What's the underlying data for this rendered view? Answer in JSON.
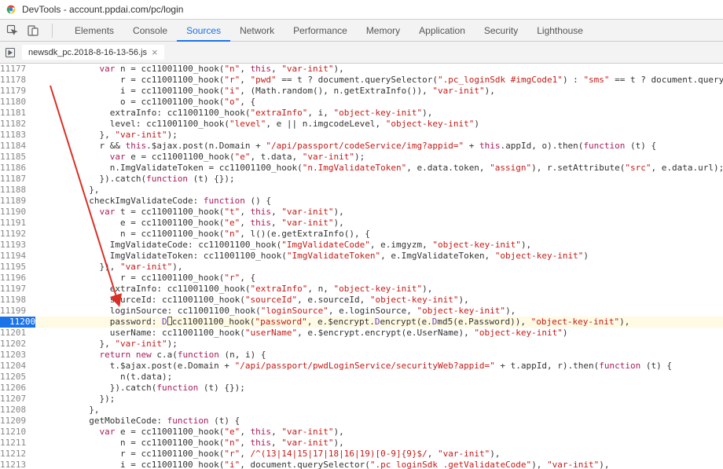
{
  "window": {
    "title": "DevTools - account.ppdai.com/pc/login"
  },
  "panels": {
    "elements": "Elements",
    "console": "Console",
    "sources": "Sources",
    "network": "Network",
    "performance": "Performance",
    "memory": "Memory",
    "application": "Application",
    "security": "Security",
    "lighthouse": "Lighthouse"
  },
  "active_panel": "sources",
  "file": {
    "name": "newsdk_pc.2018-8-16-13-56.js",
    "close": "×"
  },
  "gutter_start": 11177,
  "highlighted_line": 11200,
  "code_lines": [
    "            <kw>var</kw> n = cc11001100_hook(<str>\"n\"</str>, <kw>this</kw>, <str>\"var-init\"</str>),",
    "                r = cc11001100_hook(<str>\"r\"</str>, <str>\"pwd\"</str> == t ? document.querySelector(<str>\".pc_loginSdk #imgCode1\"</str>) : <str>\"sms\"</str> == t ? document.querySele",
    "                i = cc11001100_hook(<str>\"i\"</str>, (Math.random(), n.getExtraInfo()), <str>\"var-init\"</str>),",
    "                o = cc11001100_hook(<str>\"o\"</str>, {",
    "              extraInfo: cc11001100_hook(<str>\"extraInfo\"</str>, i, <str>\"object-key-init\"</str>),",
    "              level: cc11001100_hook(<str>\"level\"</str>, e || n.imgcodeLevel, <str>\"object-key-init\"</str>)",
    "            }, <str>\"var-init\"</str>);",
    "            r && <kw>this</kw>.$ajax.post(n.Domain + <str>\"/api/passport/codeService/img?appid=\"</str> + <kw>this</kw>.appId, o).then(<kw>function</kw> (t) {",
    "              <kw>var</kw> e = cc11001100_hook(<str>\"e\"</str>, t.data, <str>\"var-init\"</str>);",
    "              n.ImgValidateToken = cc11001100_hook(<str>\"n.ImgValidateToken\"</str>, e.data.token, <str>\"assign\"</str>), r.setAttribute(<str>\"src\"</str>, e.data.url);",
    "            }).catch(<kw>function</kw> (t) {});",
    "          },",
    "          checkImgValidateCode: <kw>function</kw> () {",
    "            <kw>var</kw> t = cc11001100_hook(<str>\"t\"</str>, <kw>this</kw>, <str>\"var-init\"</str>),",
    "                e = cc11001100_hook(<str>\"e\"</str>, <kw>this</kw>, <str>\"var-init\"</str>),",
    "                n = cc11001100_hook(<str>\"n\"</str>, l()(e.getExtraInfo(), {",
    "              ImgValidateCode: cc11001100_hook(<str>\"ImgValidateCode\"</str>, e.imgyzm, <str>\"object-key-init\"</str>),",
    "              ImgValidateToken: cc11001100_hook(<str>\"ImgValidateToken\"</str>, e.ImgValidateToken, <str>\"object-key-init\"</str>)",
    "            }), <str>\"var-init\"</str>),",
    "                r = cc11001100_hook(<str>\"r\"</str>, {",
    "              extraInfo: cc11001100_hook(<str>\"extraInfo\"</str>, n, <str>\"object-key-init\"</str>),",
    "              sourceId: cc11001100_hook(<str>\"sourceId\"</str>, e.sourceId, <str>\"object-key-init\"</str>),",
    "              loginSource: cc11001100_hook(<str>\"loginSource\"</str>, e.loginSource, <str>\"object-key-init\"</str>),",
    "              password: <prop>D</prop><cur></cur>cc11001100_hook(<str>\"password\"</str>, e.$encrypt.<prop>D</prop>encrypt(e.<prop>D</prop>md5(e.Password)), <str>\"object-key-init\"</str>),",
    "              userName: cc11001100_hook(<str>\"userName\"</str>, e.$encrypt.encrypt(e.UserName), <str>\"object-key-init\"</str>)",
    "            }, <str>\"var-init\"</str>);",
    "            <kw>return</kw> <kw>new</kw> c.a(<kw>function</kw> (n, i) {",
    "              t.$ajax.post(e.Domain + <str>\"/api/passport/pwdLoginService/securityWeb?appid=\"</str> + t.appId, r).then(<kw>function</kw> (t) {",
    "                n(t.data);",
    "              }).catch(<kw>function</kw> (t) {});",
    "            });",
    "          },",
    "          getMobileCode: <kw>function</kw> (t) {",
    "            <kw>var</kw> e = cc11001100_hook(<str>\"e\"</str>, <kw>this</kw>, <str>\"var-init\"</str>),",
    "                n = cc11001100_hook(<str>\"n\"</str>, <kw>this</kw>, <str>\"var-init\"</str>),",
    "                r = cc11001100_hook(<str>\"r\"</str>, <str>/^(13|14|15|17|18|16|19)[0-9]{9}$/</str>, <str>\"var-init\"</str>),",
    "                i = cc11001100_hook(<str>\"i\"</str>, document.querySelector(<str>\".pc_loginSdk .getValidateCode\"</str>), <str>\"var-init\"</str>),"
  ],
  "arrow": {
    "color": "#d93025"
  }
}
